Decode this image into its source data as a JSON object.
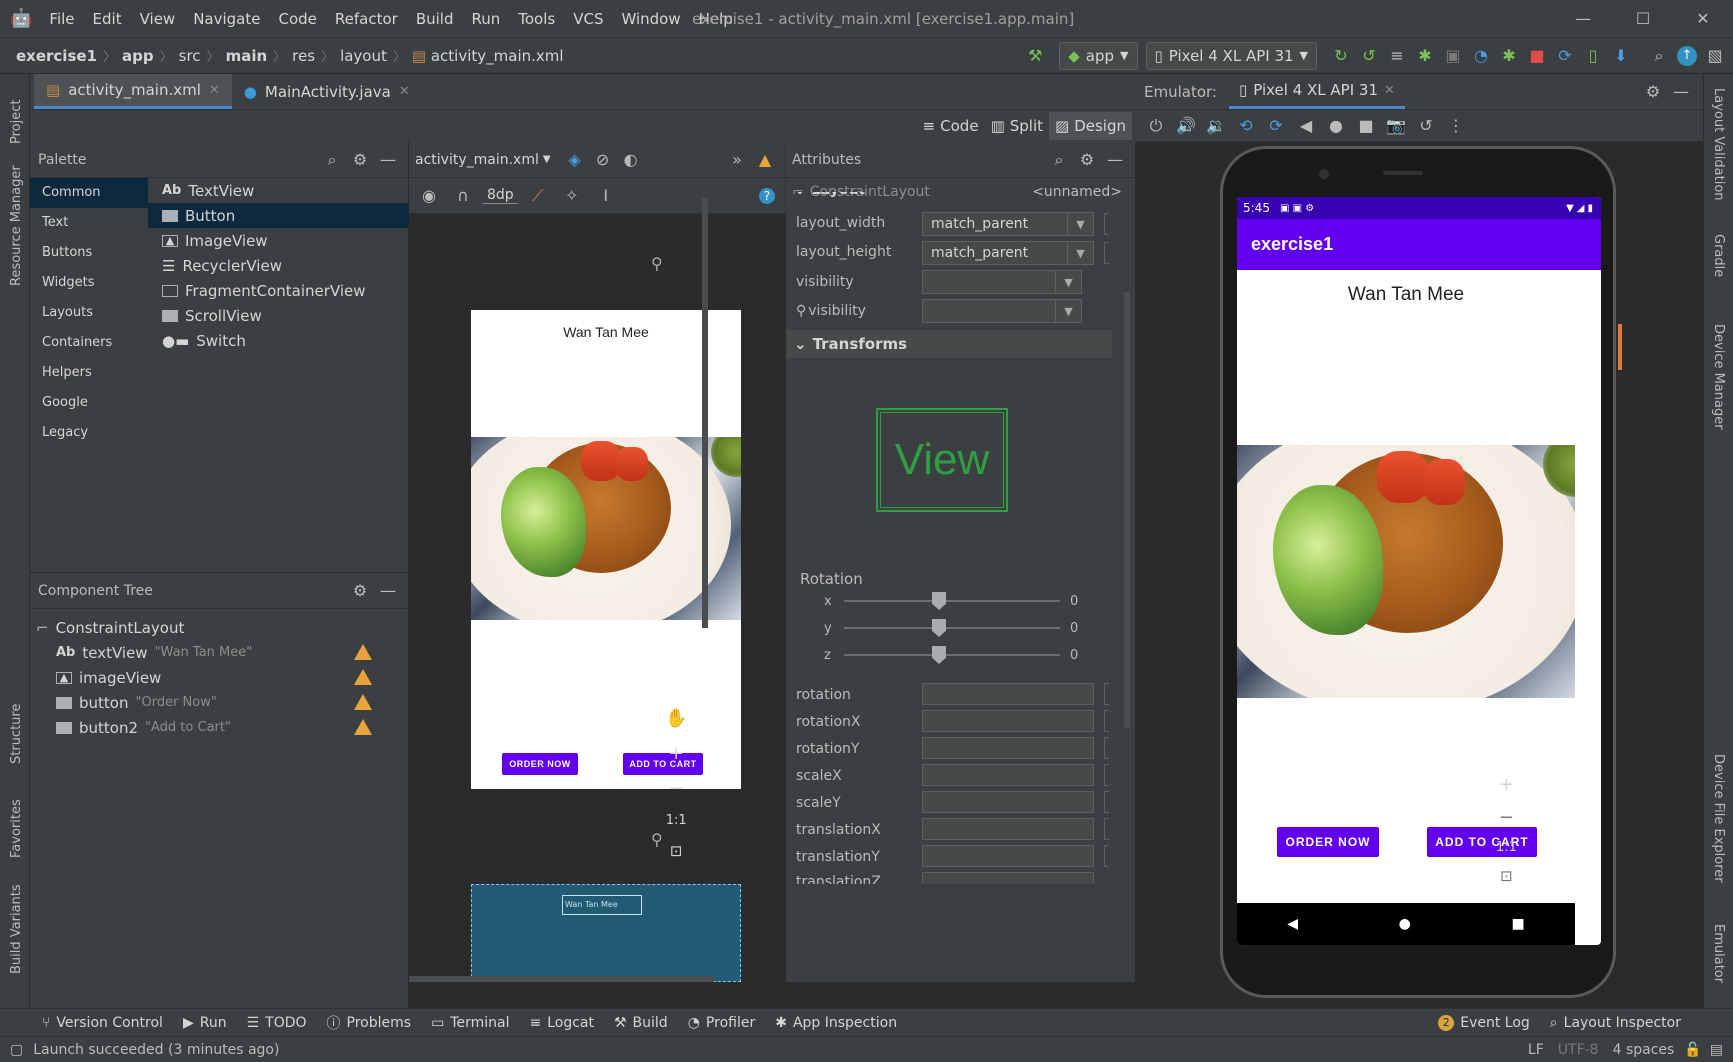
{
  "menu": [
    "File",
    "Edit",
    "View",
    "Navigate",
    "Code",
    "Refactor",
    "Build",
    "Run",
    "Tools",
    "VCS",
    "Window",
    "Help"
  ],
  "window_title": "exercise1 - activity_main.xml [exercise1.app.main]",
  "breadcrumbs": [
    "exercise1",
    "app",
    "src",
    "main",
    "res",
    "layout",
    "activity_main.xml"
  ],
  "run_config": "app",
  "device_config": "Pixel 4 XL API 31",
  "editor_tabs": [
    {
      "label": "activity_main.xml"
    },
    {
      "label": "MainActivity.java"
    }
  ],
  "view_modes": [
    "Code",
    "Split",
    "Design"
  ],
  "palette": {
    "title": "Palette",
    "categories": [
      "Common",
      "Text",
      "Buttons",
      "Widgets",
      "Layouts",
      "Containers",
      "Helpers",
      "Google",
      "Legacy"
    ],
    "items": [
      {
        "label": "TextView",
        "icon": "Ab"
      },
      {
        "label": "Button"
      },
      {
        "label": "ImageView"
      },
      {
        "label": "RecyclerView"
      },
      {
        "label": "FragmentContainerView"
      },
      {
        "label": "ScrollView"
      },
      {
        "label": "Switch"
      }
    ]
  },
  "component_tree": {
    "title": "Component Tree",
    "root": "ConstraintLayout",
    "nodes": [
      {
        "id": "textView",
        "hint": "\"Wan Tan Mee\"",
        "icon": "Ab"
      },
      {
        "id": "imageView",
        "hint": ""
      },
      {
        "id": "button",
        "hint": "\"Order Now\""
      },
      {
        "id": "button2",
        "hint": "\"Add to Cart\""
      }
    ]
  },
  "design": {
    "file_selector": "activity_main.xml",
    "margin": "8dp",
    "preview_title": "Wan Tan Mee",
    "btn_order": "ORDER NOW",
    "btn_cart": "ADD TO CART",
    "blueprint_label": "Wan Tan Mee",
    "zoom_reset": "1:1"
  },
  "attributes": {
    "title": "Attributes",
    "component": "ConstraintLayout",
    "id_value": "<unnamed>",
    "section_layout": "Layout",
    "layout_width_label": "layout_width",
    "layout_width": "match_parent",
    "layout_height_label": "layout_height",
    "layout_height": "match_parent",
    "visibility_label": "visibility",
    "visibility_tools_label": "visibility",
    "section_transforms": "Transforms",
    "view_preview": "View",
    "rotation_title": "Rotation",
    "axes": [
      {
        "axis": "x",
        "value": "0"
      },
      {
        "axis": "y",
        "value": "0"
      },
      {
        "axis": "z",
        "value": "0"
      }
    ],
    "fields": [
      "rotation",
      "rotationX",
      "rotationY",
      "scaleX",
      "scaleY",
      "translationX",
      "translationY",
      "translationZ"
    ]
  },
  "emulator": {
    "label": "Emulator:",
    "tab": "Pixel 4 XL API 31",
    "time": "5:45",
    "app_title": "exercise1",
    "text": "Wan Tan Mee",
    "btn_order": "ORDER NOW",
    "btn_cart": "ADD TO CART",
    "zoom_reset": "1:1"
  },
  "left_tools": [
    "Project",
    "Resource Manager",
    "Structure",
    "Favorites",
    "Build Variants"
  ],
  "right_tools": [
    "Layout Validation",
    "Gradle",
    "Device Manager",
    "Device File Explorer",
    "Emulator"
  ],
  "bottom_tools": [
    "Version Control",
    "Run",
    "TODO",
    "Problems",
    "Terminal",
    "Logcat",
    "Build",
    "Profiler",
    "App Inspection"
  ],
  "bottom_right_tools": [
    {
      "label": "Event Log",
      "badge": "2"
    },
    {
      "label": "Layout Inspector"
    }
  ],
  "status": {
    "message": "Launch succeeded (3 minutes ago)",
    "line_sep": "LF",
    "encoding": "UTF-8",
    "indent": "4 spaces"
  },
  "colors": {
    "accent": "#6200ee",
    "status_bar": "#3700b3",
    "warning": "#e8a33d",
    "selection": "#0d293e"
  }
}
